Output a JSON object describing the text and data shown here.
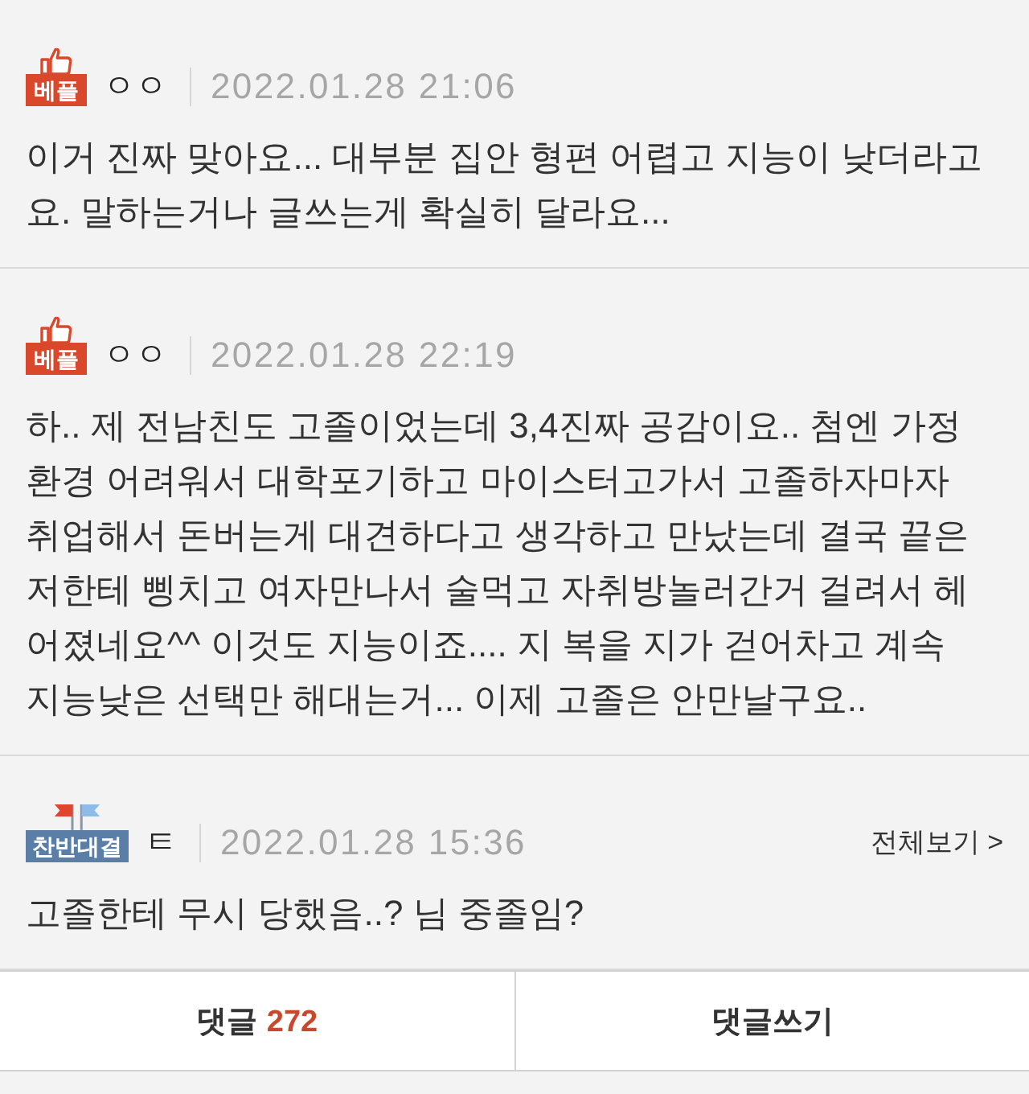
{
  "comments": [
    {
      "badge": {
        "kind": "best",
        "label": "베플"
      },
      "author": "ㅇㅇ",
      "date": "2022.01.28 21:06",
      "text": "이거 진짜 맞아요... 대부분 집안 형편 어렵고 지능이 낮더라고요. 말하는거나 글쓰는게 확실히 달라요..."
    },
    {
      "badge": {
        "kind": "best",
        "label": "베플"
      },
      "author": "ㅇㅇ",
      "date": "2022.01.28 22:19",
      "text": "하.. 제 전남친도 고졸이었는데 3,4진짜 공감이요.. 첨엔 가정환경 어려워서 대학포기하고 마이스터고가서 고졸하자마자 취업해서 돈버는게 대견하다고 생각하고 만났는데 결국 끝은 저한테 삥치고 여자만나서 술먹고 자취방놀러간거 걸려서 헤어졌네요^^ 이것도 지능이죠.... 지 복을 지가 걷어차고 계속 지능낮은 선택만 해대는거... 이제 고졸은 안만날구요.."
    },
    {
      "badge": {
        "kind": "debate",
        "label": "찬반대결"
      },
      "author": "ㅌ",
      "date": "2022.01.28 15:36",
      "more_link": "전체보기 >",
      "text": "고졸한테 무시 당했음..? 님 중졸임?"
    }
  ],
  "footer": {
    "buttons": [
      {
        "kind": "comments",
        "label": "댓글",
        "count": "272"
      },
      {
        "kind": "write",
        "label": "댓글쓰기"
      }
    ]
  }
}
